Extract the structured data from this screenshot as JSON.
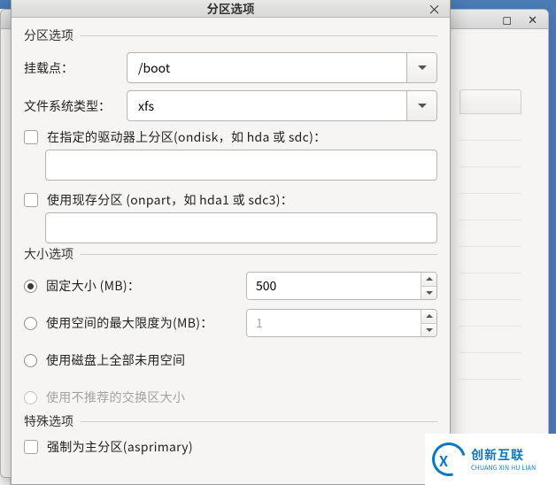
{
  "bg": {
    "max_icon": "◻",
    "close_icon": "✕"
  },
  "dialog": {
    "title": "分区选项",
    "close_icon": "×"
  },
  "section_partition": {
    "legend": "分区选项",
    "mount_label": "挂载点：",
    "mount_value": "/boot",
    "fstype_label": "文件系统类型：",
    "fstype_value": "xfs",
    "ondisk_label": "在指定的驱动器上分区(ondisk，如 hda 或 sdc)：",
    "ondisk_value": "",
    "onpart_label": "使用现存分区 (onpart，如 hda1 或 sdc3)：",
    "onpart_value": ""
  },
  "section_size": {
    "legend": "大小选项",
    "fixed_label": "固定大小 (MB)：",
    "fixed_value": "500",
    "max_label": "使用空间的最大限度为(MB)：",
    "max_value": "1",
    "fill_label": "使用磁盘上全部未用空间",
    "swap_label": "使用不推荐的交换区大小"
  },
  "section_special": {
    "legend": "特殊选项",
    "asprimary_label": "强制为主分区(asprimary)"
  },
  "watermark": {
    "cn": "创新互联",
    "en": "CHUANG XIN HU LIAN"
  }
}
